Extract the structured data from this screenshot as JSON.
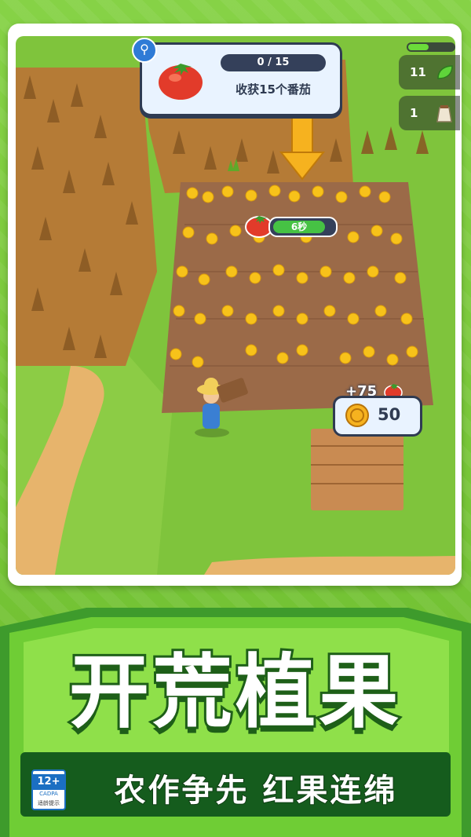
{
  "quest": {
    "progress": "0 / 15",
    "progress_fraction": 0,
    "description": "收获15个番茄",
    "icon": "tomato-icon"
  },
  "resources": {
    "leaf_count": "11",
    "leaf_icon": "leaf-icon",
    "seed_count": "1",
    "seed_icon": "seed-bag-icon"
  },
  "crop_timer": {
    "label": "6秒",
    "icon": "tomato-icon"
  },
  "reward": {
    "plus_label": "+75",
    "coin_value": "50",
    "coin_icon": "coin-icon"
  },
  "banner": {
    "title": "开荒植果",
    "subtitle": "农作争先 红果连绵"
  },
  "age_rating": {
    "value": "12+",
    "org": "CADPA",
    "tip": "适龄提示"
  },
  "colors": {
    "accent_green": "#6dbd2e",
    "banner_dark_green": "#155c1d",
    "ui_navy": "#2f3b52",
    "tomato_red": "#e23b2a"
  }
}
